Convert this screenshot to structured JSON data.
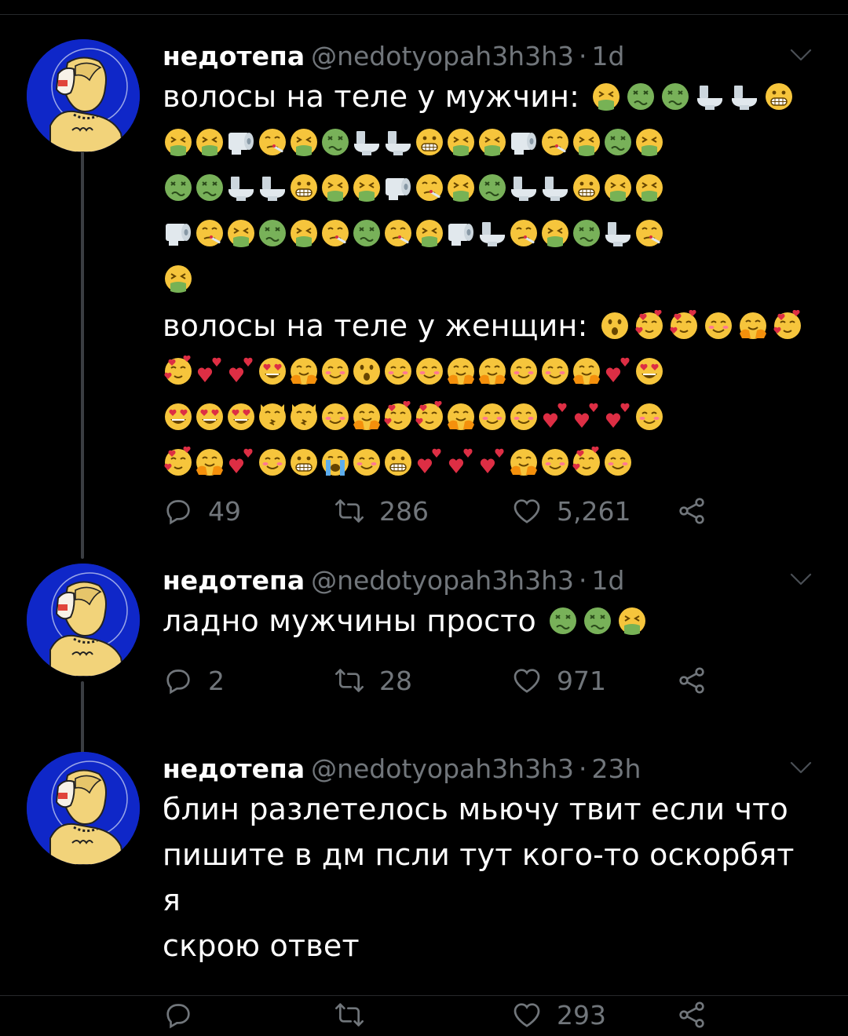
{
  "colors": {
    "background": "#000000",
    "name": "#ffffff",
    "meta": "#71767b",
    "avatar_bg": "#0f27c8"
  },
  "icons": {
    "reply": "reply-icon",
    "retweet": "retweet-icon",
    "like": "heart-icon",
    "share": "share-icon",
    "menu": "chevron-down-icon",
    "avatar": "avatar-icon"
  },
  "tweets": [
    {
      "name": "недотепа",
      "handle": "@nedotyopah3h3h3",
      "separator": "·",
      "time": "1d",
      "text_lines": [
        "волосы на теле у мужчин:",
        "волосы на теле у женщин:"
      ],
      "emoji_line1_men": [
        "vomit",
        "sick",
        "sick",
        "toilet",
        "toilet",
        "grimace"
      ],
      "emoji_men_rows": [
        [
          "vomit",
          "vomit",
          "paper",
          "fever",
          "vomit",
          "sick",
          "toilet",
          "toilet",
          "grimace",
          "vomit",
          "vomit",
          "paper",
          "fever",
          "vomit",
          "sick",
          "vomit"
        ],
        [
          "sick",
          "sick",
          "toilet",
          "toilet",
          "grimace",
          "vomit",
          "vomit",
          "paper",
          "fever",
          "vomit",
          "sick",
          "toilet",
          "toilet",
          "grimace",
          "vomit",
          "vomit"
        ],
        [
          "paper",
          "fever",
          "vomit",
          "sick",
          "vomit",
          "fever",
          "sick",
          "fever",
          "vomit",
          "paper",
          "toilet",
          "fever",
          "vomit",
          "sick",
          "toilet",
          "fever"
        ],
        [
          "vomit"
        ]
      ],
      "emoji_line1_women": [
        "wow",
        "hearts",
        "hearts",
        "blush",
        "hug",
        "hearts"
      ],
      "emoji_women_rows": [
        [
          "hearts",
          "twoheart",
          "twoheart",
          "heartseyes",
          "hug",
          "blush",
          "wow",
          "blush",
          "blush",
          "hug",
          "hug",
          "blush",
          "blush",
          "hug",
          "twoheart",
          "heartseyes"
        ],
        [
          "heartseyes",
          "heartseyes",
          "heartseyes",
          "kisscat",
          "kisscat",
          "blush",
          "hug",
          "hearts",
          "hearts",
          "hug",
          "blush",
          "blush",
          "twoheart",
          "twoheart",
          "twoheart",
          "blush"
        ],
        [
          "hearts",
          "hug",
          "twoheart",
          "blush",
          "grimace",
          "cry",
          "blush",
          "grimace",
          "twoheart",
          "twoheart",
          "twoheart",
          "hug",
          "blush",
          "hearts",
          "blush"
        ]
      ],
      "replies": "49",
      "retweets": "286",
      "likes": "5,261"
    },
    {
      "name": "недотепа",
      "handle": "@nedotyopah3h3h3",
      "separator": "·",
      "time": "1d",
      "text": "ладно мужчины просто",
      "emoji_inline": [
        "sick",
        "sick",
        "vomit"
      ],
      "replies": "2",
      "retweets": "28",
      "likes": "971"
    },
    {
      "name": "недотепа",
      "handle": "@nedotyopah3h3h3",
      "separator": "·",
      "time": "23h",
      "text_lines": [
        "блин разлетелось мьючу твит если что",
        "пишите в дм псли тут кого-то оскорбят я",
        "скрою ответ"
      ],
      "likes": "293"
    }
  ]
}
